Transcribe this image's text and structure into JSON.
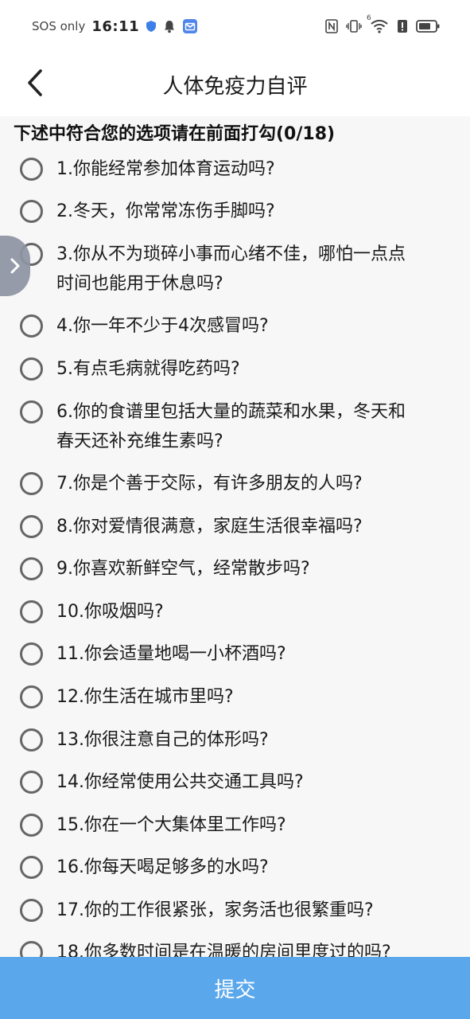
{
  "status_bar": {
    "sos_text": "SOS only",
    "time": "16:11",
    "signal_badge": "6"
  },
  "header": {
    "title": "人体免疫力自评"
  },
  "instruction": "下述中符合您的选项请在前面打勾(0/18)",
  "questions": [
    {
      "line1": "1.你能经常参加体育运动吗?",
      "line2": ""
    },
    {
      "line1": "2.冬天，你常常冻伤手脚吗?",
      "line2": ""
    },
    {
      "line1": "3.你从不为琐碎小事而心绪不佳，哪怕一点点",
      "line2": "时间也能用于休息吗?"
    },
    {
      "line1": "4.你一年不少于4次感冒吗?",
      "line2": ""
    },
    {
      "line1": "5.有点毛病就得吃药吗?",
      "line2": ""
    },
    {
      "line1": "6.你的食谱里包括大量的蔬菜和水果，冬天和",
      "line2": "春天还补充维生素吗?"
    },
    {
      "line1": "7.你是个善于交际，有许多朋友的人吗?",
      "line2": ""
    },
    {
      "line1": "8.你对爱情很满意，家庭生活很幸福吗?",
      "line2": ""
    },
    {
      "line1": "9.你喜欢新鲜空气，经常散步吗?",
      "line2": ""
    },
    {
      "line1": "10.你吸烟吗?",
      "line2": ""
    },
    {
      "line1": "11.你会适量地喝一小杯酒吗?",
      "line2": ""
    },
    {
      "line1": "12.你生活在城市里吗?",
      "line2": ""
    },
    {
      "line1": "13.你很注意自己的体形吗?",
      "line2": ""
    },
    {
      "line1": "14.你经常使用公共交通工具吗?",
      "line2": ""
    },
    {
      "line1": "15.你在一个大集体里工作吗?",
      "line2": ""
    },
    {
      "line1": "16.你每天喝足够多的水吗?",
      "line2": ""
    },
    {
      "line1": "17.你的工作很紧张，家务活也很繁重吗?",
      "line2": ""
    },
    {
      "line1": "18.你多数时间是在温暖的房间里度过的吗?",
      "line2": ""
    }
  ],
  "submit_label": "提交",
  "colors": {
    "submit_bg": "#5aa7ec",
    "content_bg": "#f7f7f7",
    "radio_border": "#666666",
    "side_tab": "#8d94a3"
  }
}
